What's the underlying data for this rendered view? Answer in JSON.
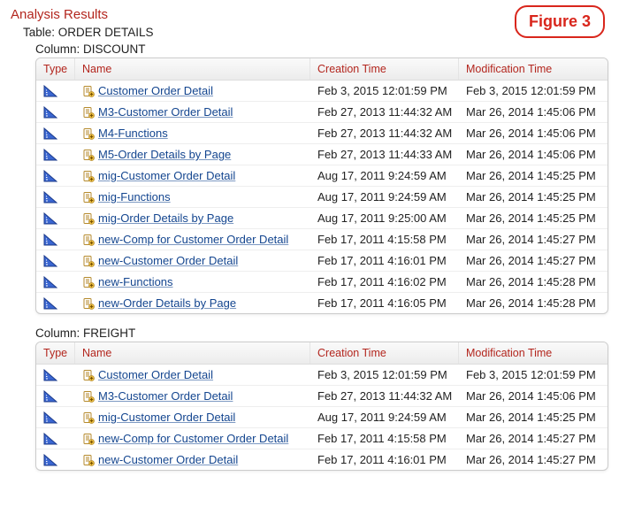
{
  "figure_label": "Figure 3",
  "title": "Analysis Results",
  "table_prefix": "Table: ",
  "table_name": "ORDER DETAILS",
  "column_prefix": "Column: ",
  "columns_headers": {
    "type": "Type",
    "name": "Name",
    "ctime": "Creation Time",
    "mtime": "Modification Time"
  },
  "sections": [
    {
      "column": "DISCOUNT",
      "rows": [
        {
          "name": "Customer Order Detail",
          "ctime": "Feb 3, 2015 12:01:59 PM",
          "mtime": "Feb 3, 2015 12:01:59 PM"
        },
        {
          "name": "M3-Customer Order Detail",
          "ctime": "Feb 27, 2013 11:44:32 AM",
          "mtime": "Mar 26, 2014 1:45:06 PM"
        },
        {
          "name": "M4-Functions",
          "ctime": "Feb 27, 2013 11:44:32 AM",
          "mtime": "Mar 26, 2014 1:45:06 PM"
        },
        {
          "name": "M5-Order Details by Page",
          "ctime": "Feb 27, 2013 11:44:33 AM",
          "mtime": "Mar 26, 2014 1:45:06 PM"
        },
        {
          "name": "mig-Customer Order Detail",
          "ctime": "Aug 17, 2011 9:24:59 AM",
          "mtime": "Mar 26, 2014 1:45:25 PM"
        },
        {
          "name": "mig-Functions",
          "ctime": "Aug 17, 2011 9:24:59 AM",
          "mtime": "Mar 26, 2014 1:45:25 PM"
        },
        {
          "name": "mig-Order Details by Page",
          "ctime": "Aug 17, 2011 9:25:00 AM",
          "mtime": "Mar 26, 2014 1:45:25 PM"
        },
        {
          "name": "new-Comp for Customer Order Detail",
          "ctime": "Feb 17, 2011 4:15:58 PM",
          "mtime": "Mar 26, 2014 1:45:27 PM"
        },
        {
          "name": "new-Customer Order Detail",
          "ctime": "Feb 17, 2011 4:16:01 PM",
          "mtime": "Mar 26, 2014 1:45:27 PM"
        },
        {
          "name": "new-Functions",
          "ctime": "Feb 17, 2011 4:16:02 PM",
          "mtime": "Mar 26, 2014 1:45:28 PM"
        },
        {
          "name": "new-Order Details by Page",
          "ctime": "Feb 17, 2011 4:16:05 PM",
          "mtime": "Mar 26, 2014 1:45:28 PM"
        }
      ]
    },
    {
      "column": "FREIGHT",
      "rows": [
        {
          "name": "Customer Order Detail",
          "ctime": "Feb 3, 2015 12:01:59 PM",
          "mtime": "Feb 3, 2015 12:01:59 PM"
        },
        {
          "name": "M3-Customer Order Detail",
          "ctime": "Feb 27, 2013 11:44:32 AM",
          "mtime": "Mar 26, 2014 1:45:06 PM"
        },
        {
          "name": "mig-Customer Order Detail",
          "ctime": "Aug 17, 2011 9:24:59 AM",
          "mtime": "Mar 26, 2014 1:45:25 PM"
        },
        {
          "name": "new-Comp for Customer Order Detail",
          "ctime": "Feb 17, 2011 4:15:58 PM",
          "mtime": "Mar 26, 2014 1:45:27 PM"
        },
        {
          "name": "new-Customer Order Detail",
          "ctime": "Feb 17, 2011 4:16:01 PM",
          "mtime": "Mar 26, 2014 1:45:27 PM"
        }
      ]
    }
  ],
  "icons": {
    "type_icon": "ruler-triangle-icon",
    "name_icon": "document-plus-icon"
  }
}
